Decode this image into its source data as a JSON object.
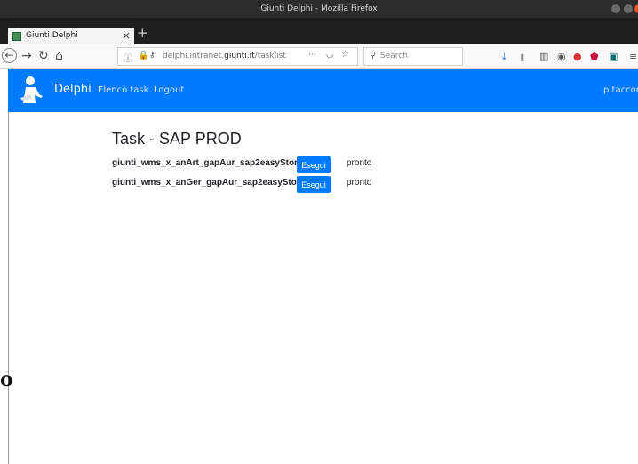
{
  "window": {
    "title": "Giunti Delphi - Mozilla Firefox"
  },
  "tabs": [
    {
      "label": "Giunti Delphi",
      "close": "×"
    }
  ],
  "newtab_label": "+",
  "url": {
    "prefix": "delphi.intranet.",
    "host": "giunti.it",
    "path": "/tasklist",
    "dots": "···"
  },
  "search": {
    "placeholder": "Search"
  },
  "app": {
    "brand": "Delphi",
    "nav": [
      "Elenco task",
      "Logout"
    ],
    "user": "p.tacconi"
  },
  "page": {
    "title": "Task - SAP PROD",
    "tasks": [
      {
        "name": "giunti_wms_x_anArt_gapAur_sap2easyStor",
        "button": "Esegui",
        "status": "pronto"
      },
      {
        "name": "giunti_wms_x_anGer_gapAur_sap2easyStor",
        "button": "Esegui",
        "status": "pronto"
      }
    ]
  },
  "stray_glyph": "o",
  "colors": {
    "accent": "#007bff",
    "titlebar": "#2c2c2c",
    "tabbar": "#1f1f1f"
  }
}
